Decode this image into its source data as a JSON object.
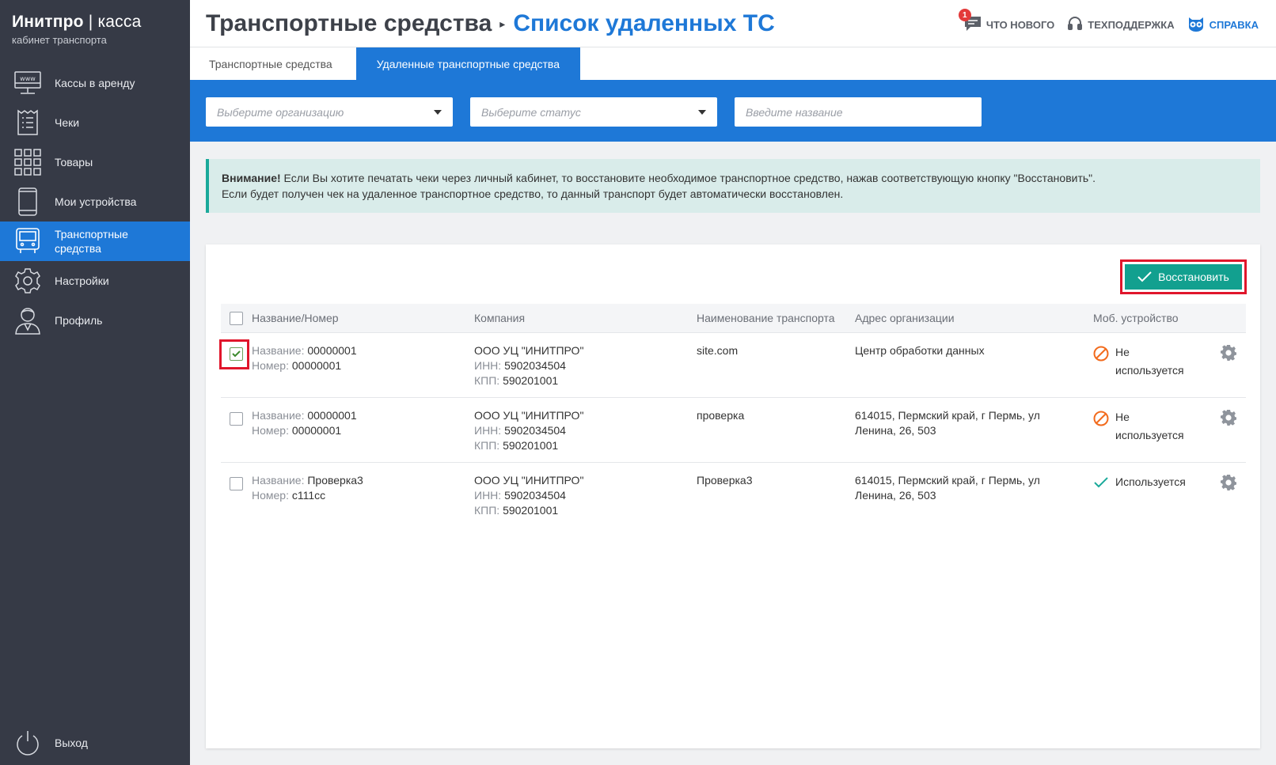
{
  "brand": {
    "title_bold": "Инитпро",
    "title_sep": " | ",
    "title_light": "касса",
    "subtitle": "кабинет транспорта"
  },
  "sidebar": {
    "items": [
      {
        "label": "Кассы в аренду",
        "icon": "www-monitor-icon",
        "active": false
      },
      {
        "label": "Чеки",
        "icon": "receipt-icon",
        "active": false
      },
      {
        "label": "Товары",
        "icon": "grid-icon",
        "active": false
      },
      {
        "label": "Мои устройства",
        "icon": "phone-icon",
        "active": false
      },
      {
        "label": "Транспортные средства",
        "icon": "bus-icon",
        "active": true
      },
      {
        "label": "Настройки",
        "icon": "gear-icon",
        "active": false
      },
      {
        "label": "Профиль",
        "icon": "user-icon",
        "active": false
      }
    ],
    "logout": "Выход"
  },
  "header": {
    "breadcrumb_parent": "Транспортные средства",
    "breadcrumb_current": "Список удаленных ТС",
    "whats_new": "Что нового",
    "whats_new_badge": "1",
    "support": "Техподдержка",
    "help": "Справка"
  },
  "tabs": [
    {
      "label": "Транспортные средства",
      "active": false
    },
    {
      "label": "Удаленные транспортные средства",
      "active": true
    }
  ],
  "filters": {
    "organization_placeholder": "Выберите организацию",
    "status_placeholder": "Выберите статус",
    "name_placeholder": "Введите название"
  },
  "notice": {
    "bold": "Внимание!",
    "line1": " Если Вы хотите печатать чеки через личный кабинет, то восстановите необходимое транспортное средство, нажав соответствующую кнопку \"Восстановить\".",
    "line2": "Если будет получен чек на удаленное транспортное средство, то данный транспорт будет автоматически восстановлен."
  },
  "restore_button": "Восстановить",
  "table": {
    "headers": {
      "name": "Название/Номер",
      "company": "Компания",
      "transport": "Наименование транспорта",
      "address": "Адрес организации",
      "mobile": "Моб. устройство"
    },
    "labels": {
      "name": "Название:",
      "number": "Номер:",
      "inn": "ИНН:",
      "kpp": "КПП:"
    },
    "rows": [
      {
        "checked": true,
        "name": "00000001",
        "number": "00000001",
        "company": "ООО УЦ \"ИНИТПРО\"",
        "inn": "5902034504",
        "kpp": "590201001",
        "transport": "site.com",
        "address": "Центр обработки данных",
        "mobile_status": "Не используется",
        "mobile_in_use": false
      },
      {
        "checked": false,
        "name": "00000001",
        "number": "00000001",
        "company": "ООО УЦ \"ИНИТПРО\"",
        "inn": "5902034504",
        "kpp": "590201001",
        "transport": "проверка",
        "address": "614015, Пермский край, г Пермь, ул Ленина, 26, 503",
        "mobile_status": "Не используется",
        "mobile_in_use": false
      },
      {
        "checked": false,
        "name": "Проверка3",
        "number": "с111сс",
        "company": "ООО УЦ \"ИНИТПРО\"",
        "inn": "5902034504",
        "kpp": "590201001",
        "transport": "Проверка3",
        "address": "614015, Пермский край, г Пермь, ул Ленина, 26, 503",
        "mobile_status": "Используется",
        "mobile_in_use": true
      }
    ]
  },
  "colors": {
    "accent": "#1e78d7",
    "sidebar": "#363a46",
    "restore": "#12a08f",
    "highlight": "#e0162b",
    "warning": "#f26b1d",
    "ok": "#1aa99a"
  }
}
